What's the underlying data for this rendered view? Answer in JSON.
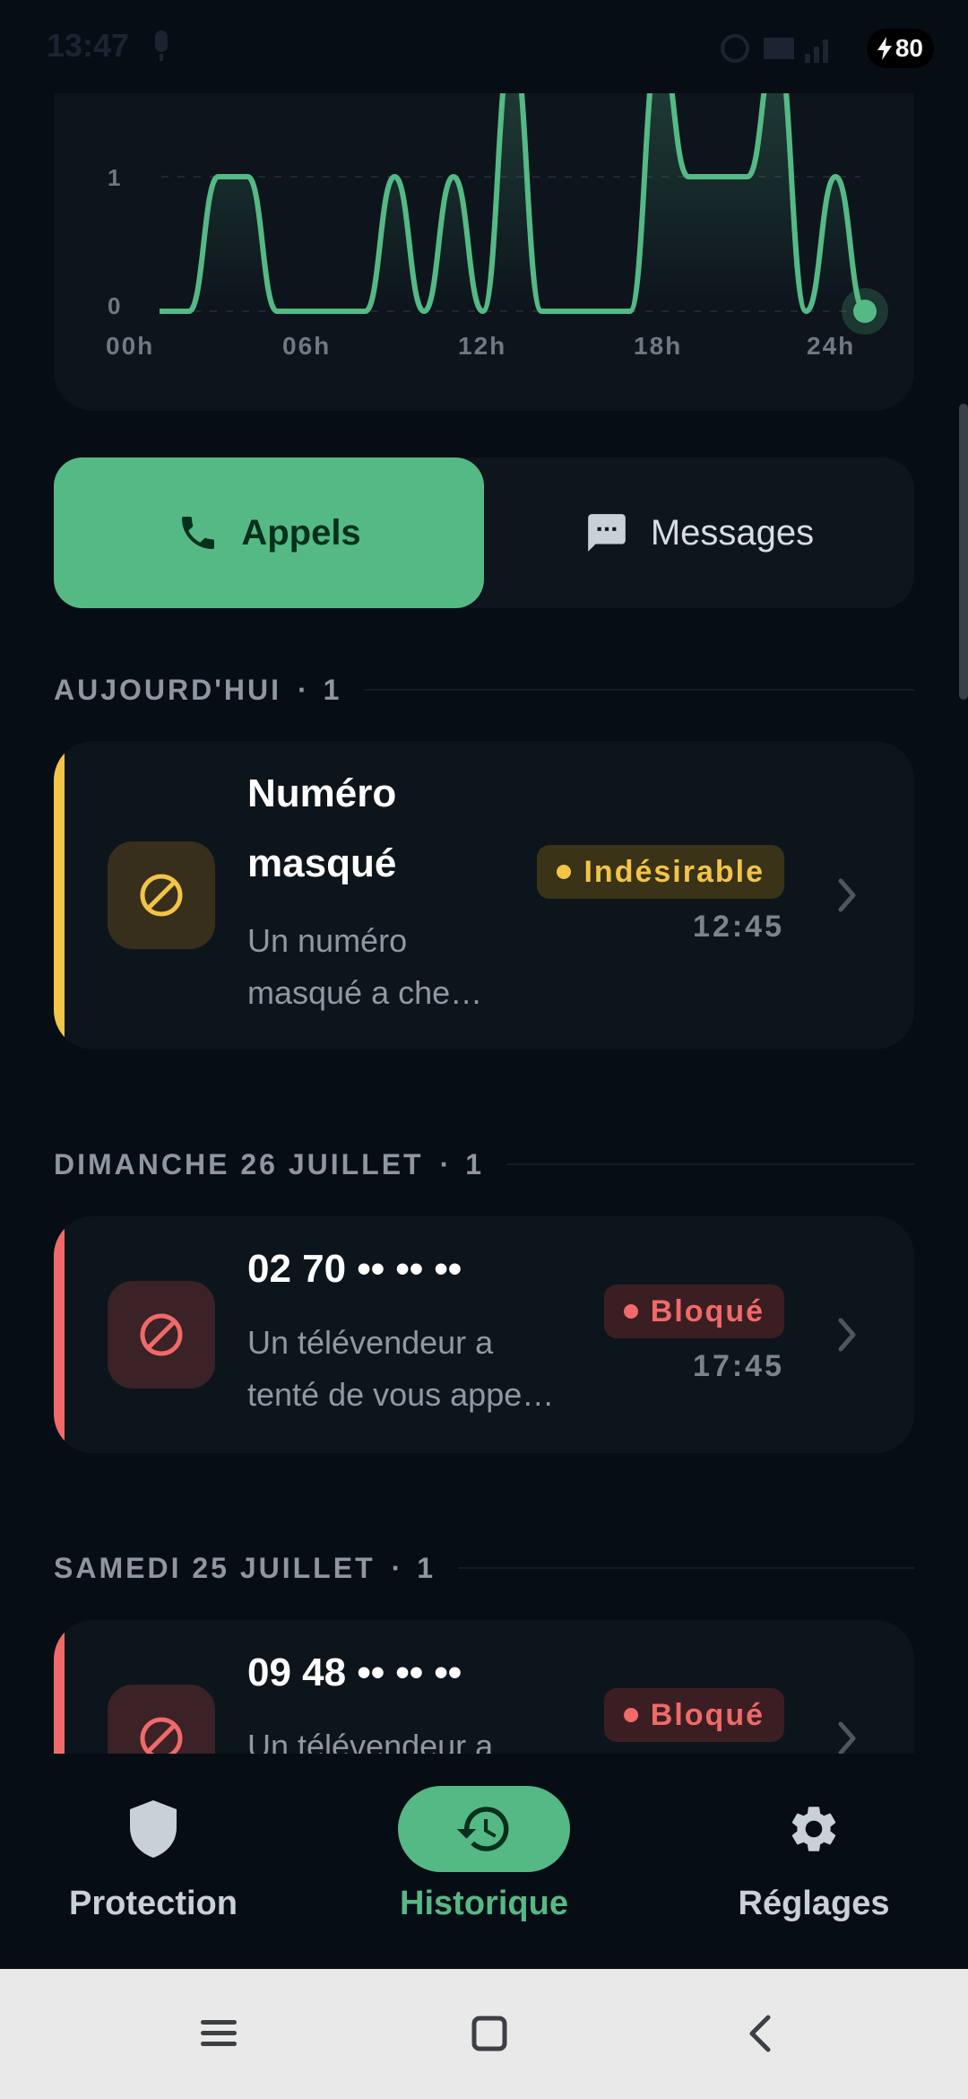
{
  "status_bar": {
    "time": "13:47",
    "battery": "80"
  },
  "chart_data": {
    "type": "area",
    "x_ticks": [
      "00h",
      "06h",
      "12h",
      "18h",
      "24h"
    ],
    "y_ticks": [
      "0",
      "1"
    ],
    "hours": [
      0,
      1,
      2,
      3,
      4,
      5,
      6,
      7,
      8,
      9,
      10,
      11,
      12,
      13,
      14,
      15,
      16,
      17,
      18,
      19,
      20,
      21,
      22,
      23,
      24
    ],
    "values": [
      0,
      0,
      1,
      1,
      0,
      0,
      0,
      0,
      1,
      0,
      1,
      0,
      2,
      0,
      0,
      0,
      0,
      2,
      1,
      1,
      1,
      2,
      0,
      1,
      0
    ],
    "y_range": [
      0,
      2
    ],
    "grid": true,
    "color": "#55b986"
  },
  "tabs": {
    "calls": "Appels",
    "messages": "Messages"
  },
  "sections": [
    {
      "title": "AUJOURD'HUI",
      "count": "1",
      "card": {
        "title_line1": "Numéro",
        "title_line2": "masqué",
        "desc_line1": "Un numéro",
        "desc_line2": "masqué a che…",
        "badge": "Indésirable",
        "time": "12:45",
        "accent": "#f2c448"
      }
    },
    {
      "title": "DIMANCHE 26 JUILLET",
      "count": "1",
      "card": {
        "title": "02 70 •• •• ••",
        "desc_line1": "Un télévendeur a",
        "desc_line2": "tenté de vous appe…",
        "badge": "Bloqué",
        "time": "17:45",
        "accent": "#f06a6a"
      }
    },
    {
      "title": "SAMEDI 25 JUILLET",
      "count": "1",
      "card": {
        "title": "09 48 •• •• ••",
        "desc_line1": "Un télévendeur a",
        "badge": "Bloqué",
        "accent": "#f06a6a"
      }
    }
  ],
  "bottom_nav": {
    "protection": "Protection",
    "history": "Historique",
    "settings": "Réglages"
  },
  "colors": {
    "accent_green": "#55b986",
    "warning_yellow": "#f2c448",
    "blocked_red": "#f06a6a"
  }
}
